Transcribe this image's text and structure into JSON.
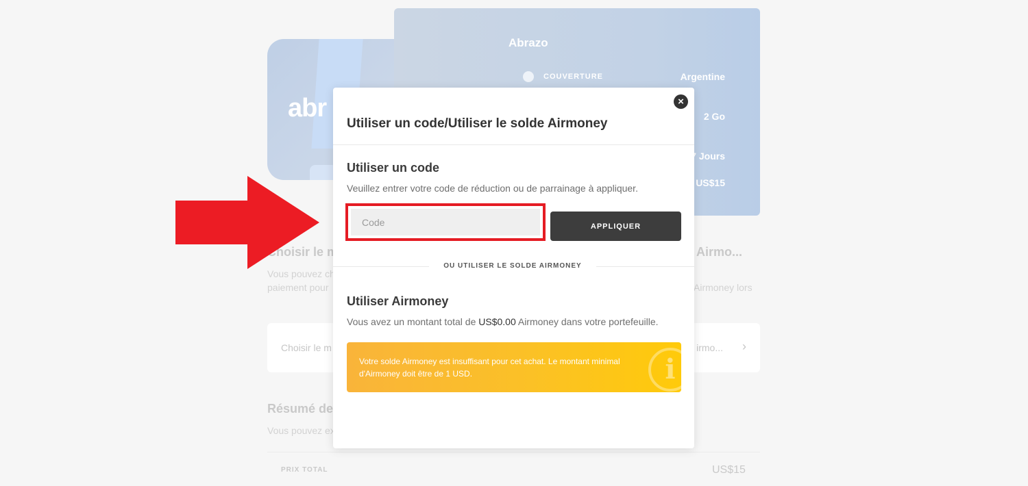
{
  "background": {
    "plan_name": "Abrazo",
    "card_logo": "abr",
    "info_rows": [
      {
        "label": "COUVERTURE",
        "value": "Argentine",
        "icon": "globe-icon"
      },
      {
        "label": "",
        "value": "2 Go",
        "icon": ""
      },
      {
        "label": "",
        "value": "7 Jours",
        "icon": ""
      },
      {
        "label": "",
        "value": "US$15",
        "icon": ""
      }
    ],
    "payment_title_left": "Choisir le m",
    "payment_title_right": "Airmo...",
    "payment_desc_left_1": "Vous pouvez ch",
    "payment_desc_left_2": "paiement pour",
    "payment_desc_right": "Airmoney lors",
    "select_left": "Choisir le m",
    "select_right": "irmo...",
    "summary_title": "Résumé de",
    "summary_desc": "Vous pouvez ex",
    "total_label": "PRIX TOTAL",
    "total_value": "US$15"
  },
  "modal": {
    "title": "Utiliser un code/Utiliser le solde Airmoney",
    "code_section": {
      "title": "Utiliser un code",
      "description": "Veuillez entrer votre code de réduction ou de parrainage à appliquer.",
      "input_placeholder": "Code",
      "input_value": "",
      "apply_label": "APPLIQUER"
    },
    "divider_label": "OU UTILISER LE SOLDE AIRMONEY",
    "airmoney_section": {
      "title": "Utiliser Airmoney",
      "desc_before": "Vous avez un montant total de ",
      "amount": "US$0.00",
      "desc_after": " Airmoney dans votre portefeuille.",
      "alert": "Votre solde Airmoney est insuffisant pour cet achat. Le montant minimal d'Airmoney doit être de 1 USD.",
      "alert_icon": "info-icon"
    }
  },
  "colors": {
    "arrow": "#ec1c24",
    "highlight_border": "#e51c24",
    "apply_button": "#3d3d3d",
    "alert_start": "#f9b43a",
    "alert_end": "#ffca0a"
  }
}
